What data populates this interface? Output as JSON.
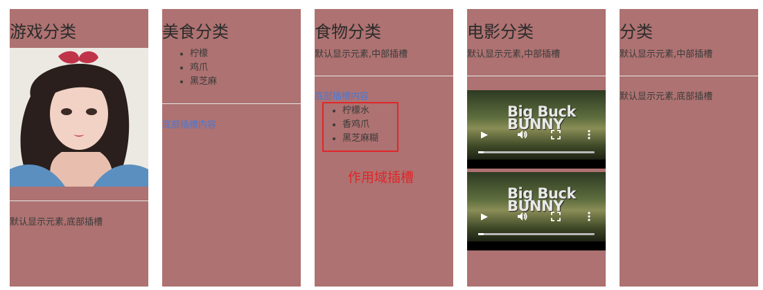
{
  "cards": [
    {
      "title": "游戏分类",
      "footer_text": "默认显示元素,底部插槽"
    },
    {
      "title": "美食分类",
      "items": [
        "柠檬",
        "鸡爪",
        "黑芝麻"
      ],
      "footer_link": "底部插槽内容"
    },
    {
      "title": "食物分类",
      "middle_text": "默认显示元素,中部插槽",
      "footer_link": "底部插槽内容",
      "items": [
        "柠檬水",
        "香鸡爪",
        "黑芝麻糊"
      ]
    },
    {
      "title": "电影分类",
      "middle_text": "默认显示元素,中部插槽",
      "videos": [
        {
          "title_line1": "Big Buck",
          "title_line2": "BUNNY"
        },
        {
          "title_line1": "Big Buck",
          "title_line2": "BUNNY"
        }
      ]
    },
    {
      "title": "分类",
      "middle_text": "默认显示元素,中部插槽",
      "footer_text": "默认显示元素,底部插槽"
    }
  ],
  "annotation": {
    "label": "作用域插槽",
    "color": "#e0262a"
  },
  "colors": {
    "card_background": "#ad7271",
    "link": "#4a78d4"
  }
}
